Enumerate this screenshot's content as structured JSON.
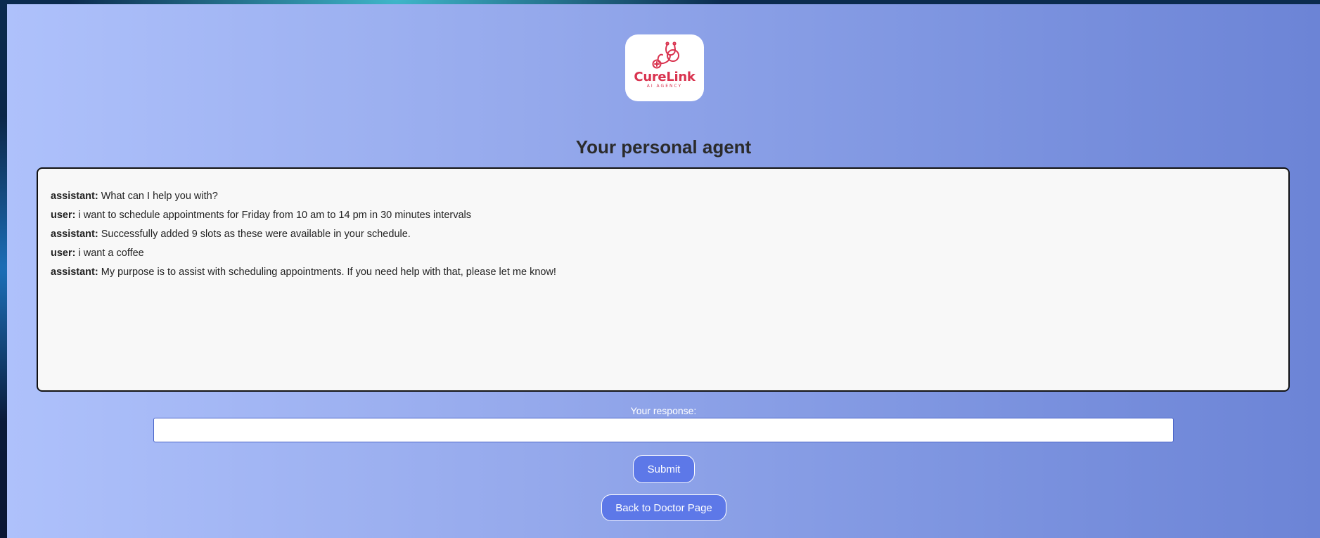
{
  "brand": {
    "name": "CureLink",
    "tagline": "AI AGENCY",
    "logo_color": "#d9334f",
    "icon": "stethoscope-icon"
  },
  "page": {
    "title": "Your personal agent"
  },
  "chat": {
    "messages": [
      {
        "role": "assistant:",
        "text": "What can I help you with?"
      },
      {
        "role": "user:",
        "text": "i want to schedule appointments for Friday from 10 am to 14 pm in 30 minutes intervals"
      },
      {
        "role": "assistant:",
        "text": "Successfully added 9 slots as these were available in your schedule."
      },
      {
        "role": "user:",
        "text": "i want a coffee"
      },
      {
        "role": "assistant:",
        "text": "My purpose is to assist with scheduling appointments. If you need help with that, please let me know!"
      }
    ]
  },
  "response": {
    "label": "Your response:",
    "value": "",
    "placeholder": ""
  },
  "buttons": {
    "submit_label": "Submit",
    "back_label": "Back to Doctor Page"
  },
  "colors": {
    "button_bg": "#5d78e8",
    "accent_border": "#4a64c8"
  }
}
